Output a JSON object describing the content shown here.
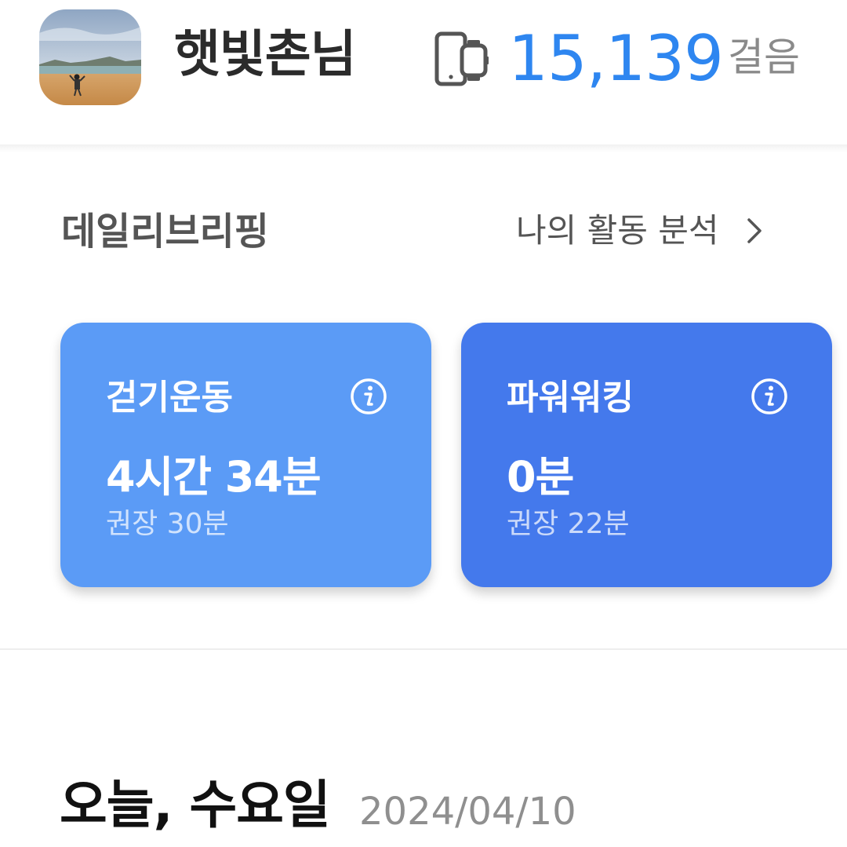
{
  "profile": {
    "username": "햇빛촌님",
    "avatar_icon": "avatar-beach-photo"
  },
  "steps": {
    "device_icon": "phone-watch-icon",
    "value": "15,139",
    "unit": "걸음"
  },
  "briefing": {
    "title": "데일리브리핑",
    "analysis_link": "나의 활동 분석",
    "analysis_icon": "chevron-right-icon"
  },
  "cards": [
    {
      "title": "걷기운동",
      "value": "4시간 34분",
      "recommend": "권장 30분",
      "color": "#5b9bf6",
      "info_icon": "info-icon"
    },
    {
      "title": "파워워킹",
      "value": "0분",
      "recommend": "권장 22분",
      "color": "#4479ec",
      "info_icon": "info-icon"
    }
  ],
  "today": {
    "label": "오늘, 수요일",
    "date": "2024/04/10"
  },
  "colors": {
    "accent": "#2e86f0",
    "text_dark": "#2b2b2b",
    "text_muted": "#8a8a8a"
  }
}
